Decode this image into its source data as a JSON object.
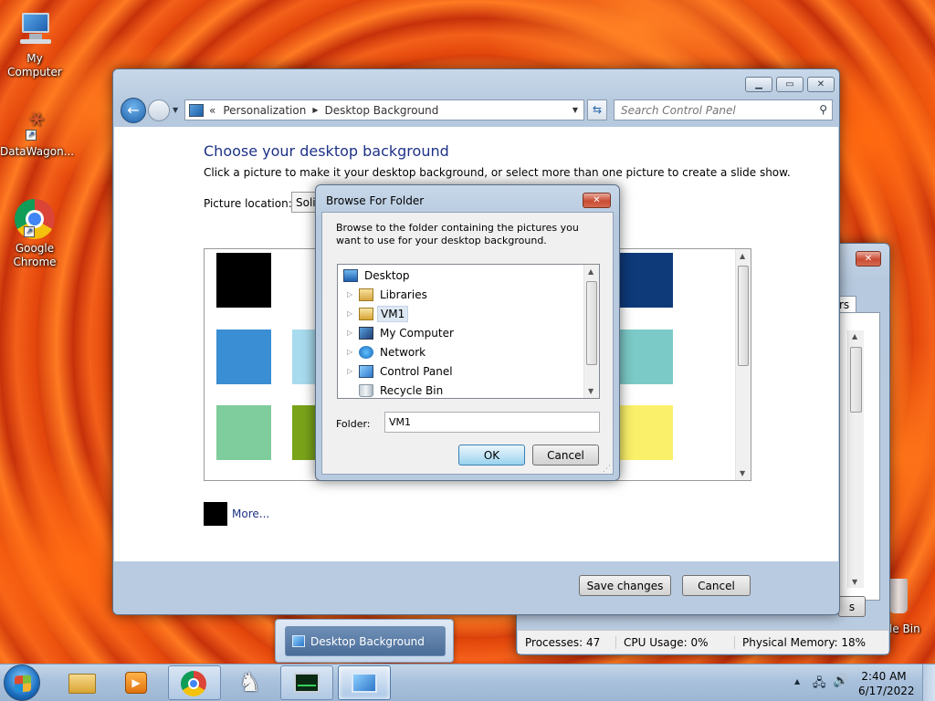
{
  "desktop": {
    "icons": [
      {
        "label": "My Computer"
      },
      {
        "label": "DataWagon..."
      },
      {
        "label": "Google\nChrome"
      }
    ],
    "recycle_label_partial": "le Bin"
  },
  "control_panel": {
    "breadcrumb_prefix": "«",
    "breadcrumb": [
      "Personalization",
      "Desktop Background"
    ],
    "search_placeholder": "Search Control Panel",
    "heading": "Choose your desktop background",
    "subheading": "Click a picture to make it your desktop background, or select more than one picture to create a slide show.",
    "picture_location_label": "Picture location:",
    "picture_location_value": "Solic",
    "more_link": "More...",
    "save_button": "Save changes",
    "cancel_button": "Cancel",
    "swatch_colors": [
      "#000000",
      "#0e3a7a",
      "#3a8ed4",
      "#a8dbee",
      "#7ccac8",
      "#7fcc9c",
      "#7aa31a",
      "#fbf06a"
    ],
    "more_color": "#000000"
  },
  "task_manager": {
    "tab_partial": "rs",
    "button_partial": "s",
    "processes": "Processes: 47",
    "cpu": "CPU Usage: 0%",
    "memory": "Physical Memory: 18%"
  },
  "browse_dialog": {
    "title": "Browse For Folder",
    "description": "Browse to the folder containing the pictures you want to use for your desktop background.",
    "tree": [
      {
        "label": "Desktop",
        "icon": "desktop-icon",
        "indent": 0,
        "expander": false,
        "selected": false
      },
      {
        "label": "Libraries",
        "icon": "libraries-icon",
        "indent": 1,
        "expander": true,
        "selected": false
      },
      {
        "label": "VM1",
        "icon": "user-folder-icon",
        "indent": 1,
        "expander": true,
        "selected": true
      },
      {
        "label": "My Computer",
        "icon": "computer-icon",
        "indent": 1,
        "expander": true,
        "selected": false
      },
      {
        "label": "Network",
        "icon": "network-icon",
        "indent": 1,
        "expander": true,
        "selected": false
      },
      {
        "label": "Control Panel",
        "icon": "control-panel-icon",
        "indent": 1,
        "expander": true,
        "selected": false
      },
      {
        "label": "Recycle Bin",
        "icon": "recycle-bin-icon",
        "indent": 1,
        "expander": false,
        "selected": false
      }
    ],
    "folder_label": "Folder:",
    "folder_value": "VM1",
    "ok_button": "OK",
    "cancel_button": "Cancel"
  },
  "taskbar": {
    "preview_title": "Desktop Background",
    "time": "2:40 AM",
    "date": "6/17/2022",
    "pinned": [
      "explorer-icon",
      "media-player-icon",
      "chrome-icon",
      "chess-icon",
      "task-manager-icon",
      "control-panel-icon"
    ]
  }
}
